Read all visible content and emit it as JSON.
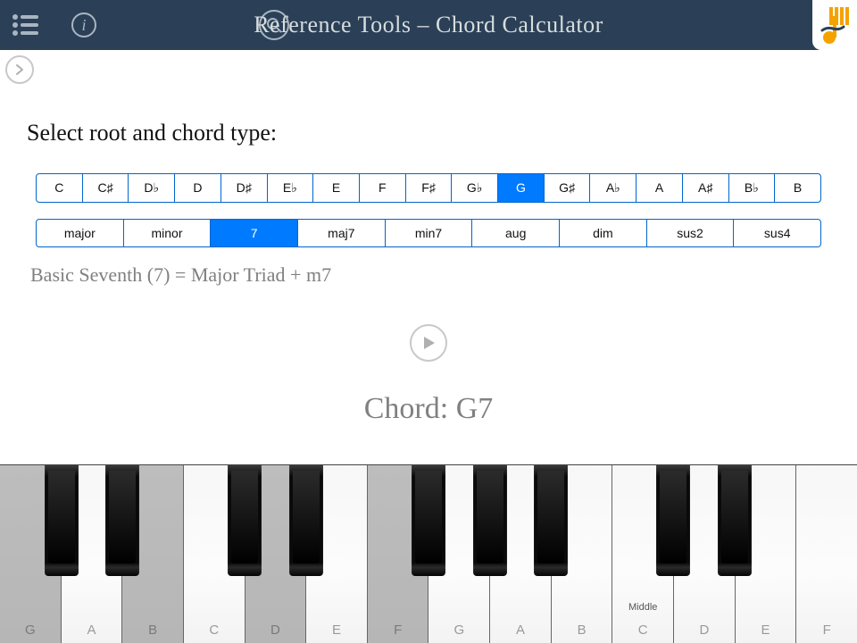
{
  "header": {
    "title": "Reference Tools – Chord Calculator"
  },
  "prompt": "Select root and chord type:",
  "roots": [
    "C",
    "C♯",
    "D♭",
    "D",
    "D♯",
    "E♭",
    "E",
    "F",
    "F♯",
    "G♭",
    "G",
    "G♯",
    "A♭",
    "A",
    "A♯",
    "B♭",
    "B"
  ],
  "root_selected_index": 10,
  "chord_types": [
    "major",
    "minor",
    "7",
    "maj7",
    "min7",
    "aug",
    "dim",
    "sus2",
    "sus4"
  ],
  "chord_type_selected_index": 2,
  "description": "Basic Seventh (7) = Major Triad + m7",
  "chord_label": "Chord: G7",
  "keyboard": {
    "white_labels": [
      "G",
      "A",
      "B",
      "C",
      "D",
      "E",
      "F",
      "G",
      "A",
      "B",
      "C",
      "D",
      "E",
      "F"
    ],
    "pressed_white_indices": [
      0,
      2,
      4,
      6
    ],
    "middle_label": "Middle",
    "middle_index": 10
  },
  "colors": {
    "header_bg": "#2b4057",
    "accent": "#007aff",
    "border": "#0066cc"
  }
}
